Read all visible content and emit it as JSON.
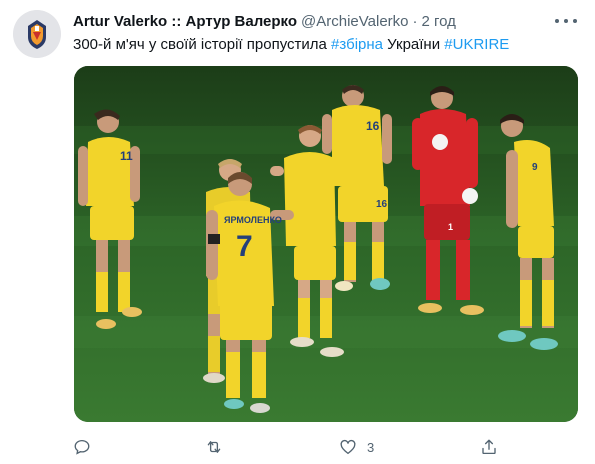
{
  "tweet": {
    "author_name": "Artur Valerko :: Артур Валерко",
    "author_handle": "@ArchieValerko",
    "separator": "·",
    "time": "2 год",
    "text_plain": "300-й м'яч у своїй історії пропустила ",
    "hashtag1": "#збірна",
    "text_mid": " України ",
    "hashtag2": "#UKRIRE",
    "image_alt": "Photo of Ukraine national football team players on the pitch",
    "player_name_on_shirt": "ЯРМОЛЕНКО",
    "jersey_numbers": [
      "11",
      "16",
      "7",
      "16",
      "1",
      "9"
    ]
  },
  "actions": {
    "reply_icon": "reply-icon",
    "retweet_icon": "retweet-icon",
    "like_icon": "like-icon",
    "like_count": "3",
    "share_icon": "share-icon"
  },
  "colors": {
    "accent": "#1d9bf0",
    "secondary_text": "#536471",
    "jersey_yellow": "#f2d42a",
    "keeper_red": "#d8262a",
    "pitch_green": "#2f6a2a"
  }
}
